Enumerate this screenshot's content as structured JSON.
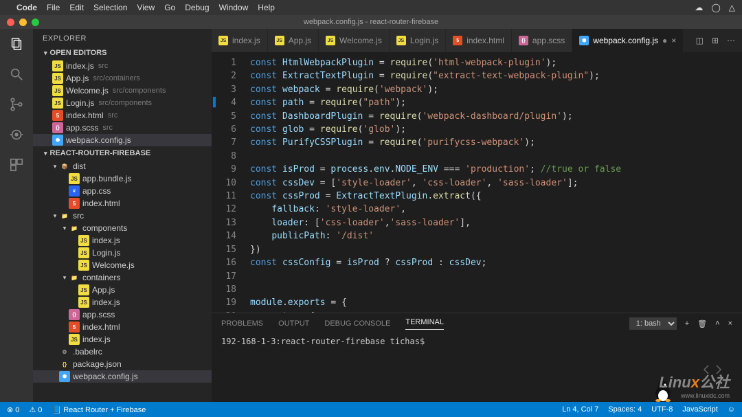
{
  "mac_menu": {
    "apple": "",
    "items": [
      "Code",
      "File",
      "Edit",
      "Selection",
      "View",
      "Go",
      "Debug",
      "Window",
      "Help"
    ],
    "right": [
      "☁",
      "◯",
      "△"
    ]
  },
  "titlebar": {
    "title": "webpack.config.js - react-router-firebase"
  },
  "sidebar": {
    "title": "EXPLORER",
    "open_editors_header": "OPEN EDITORS",
    "open_editors": [
      {
        "icon": "js",
        "name": "index.js",
        "desc": "src"
      },
      {
        "icon": "js",
        "name": "App.js",
        "desc": "src/containers"
      },
      {
        "icon": "js",
        "name": "Welcome.js",
        "desc": "src/components"
      },
      {
        "icon": "js",
        "name": "Login.js",
        "desc": "src/components"
      },
      {
        "icon": "html",
        "name": "index.html",
        "desc": "src"
      },
      {
        "icon": "scss",
        "name": "app.scss",
        "desc": "src"
      },
      {
        "icon": "cfg",
        "name": "webpack.config.js",
        "desc": "",
        "selected": true
      }
    ],
    "project_header": "REACT-ROUTER-FIREBASE",
    "tree": [
      {
        "depth": 1,
        "tw": "▾",
        "icon": "dist",
        "glyph": "📦",
        "name": "dist"
      },
      {
        "depth": 2,
        "icon": "js",
        "name": "app.bundle.js"
      },
      {
        "depth": 2,
        "icon": "css",
        "name": "app.css"
      },
      {
        "depth": 2,
        "icon": "html",
        "name": "index.html"
      },
      {
        "depth": 1,
        "tw": "▾",
        "icon": "src",
        "glyph": "📁",
        "name": "src"
      },
      {
        "depth": 2,
        "tw": "▾",
        "icon": "fold",
        "glyph": "📁",
        "name": "components"
      },
      {
        "depth": 3,
        "icon": "js",
        "name": "index.js"
      },
      {
        "depth": 3,
        "icon": "js",
        "name": "Login.js"
      },
      {
        "depth": 3,
        "icon": "js",
        "name": "Welcome.js"
      },
      {
        "depth": 2,
        "tw": "▾",
        "icon": "fold",
        "glyph": "📁",
        "name": "containers"
      },
      {
        "depth": 3,
        "icon": "js",
        "name": "App.js"
      },
      {
        "depth": 3,
        "icon": "js",
        "name": "index.js"
      },
      {
        "depth": 2,
        "icon": "scss",
        "name": "app.scss"
      },
      {
        "depth": 2,
        "icon": "html",
        "name": "index.html"
      },
      {
        "depth": 2,
        "icon": "js",
        "name": "index.js"
      },
      {
        "depth": 1,
        "icon": "babel",
        "glyph": "⚙",
        "name": ".babelrc"
      },
      {
        "depth": 1,
        "icon": "json",
        "glyph": "{}",
        "name": "package.json"
      },
      {
        "depth": 1,
        "icon": "cfg",
        "name": "webpack.config.js",
        "selected": true
      }
    ]
  },
  "tabs": [
    {
      "icon": "js",
      "label": "index.js"
    },
    {
      "icon": "js",
      "label": "App.js"
    },
    {
      "icon": "js",
      "label": "Welcome.js"
    },
    {
      "icon": "js",
      "label": "Login.js"
    },
    {
      "icon": "html",
      "label": "index.html"
    },
    {
      "icon": "scss",
      "label": "app.scss"
    },
    {
      "icon": "cfg",
      "label": "webpack.config.js",
      "active": true,
      "dirty": true
    }
  ],
  "code": {
    "lines": [
      [
        {
          "t": "const ",
          "c": "kw"
        },
        {
          "t": "HtmlWebpackPlugin",
          "c": "vr"
        },
        {
          "t": " = ",
          "c": "op"
        },
        {
          "t": "require",
          "c": "fn"
        },
        {
          "t": "(",
          "c": "op"
        },
        {
          "t": "'html-webpack-plugin'",
          "c": "st"
        },
        {
          "t": ");",
          "c": "op"
        }
      ],
      [
        {
          "t": "const ",
          "c": "kw"
        },
        {
          "t": "ExtractTextPlugin",
          "c": "vr"
        },
        {
          "t": " = ",
          "c": "op"
        },
        {
          "t": "require",
          "c": "fn"
        },
        {
          "t": "(",
          "c": "op"
        },
        {
          "t": "\"extract-text-webpack-plugin\"",
          "c": "st"
        },
        {
          "t": ");",
          "c": "op"
        }
      ],
      [
        {
          "t": "const ",
          "c": "kw"
        },
        {
          "t": "webpack",
          "c": "vr"
        },
        {
          "t": " = ",
          "c": "op"
        },
        {
          "t": "require",
          "c": "fn"
        },
        {
          "t": "(",
          "c": "op"
        },
        {
          "t": "'webpack'",
          "c": "st"
        },
        {
          "t": ");",
          "c": "op"
        }
      ],
      [
        {
          "t": "const ",
          "c": "kw"
        },
        {
          "t": "path",
          "c": "vr"
        },
        {
          "t": " = ",
          "c": "op"
        },
        {
          "t": "require",
          "c": "fn"
        },
        {
          "t": "(",
          "c": "op"
        },
        {
          "t": "\"path\"",
          "c": "st"
        },
        {
          "t": ");",
          "c": "op"
        }
      ],
      [
        {
          "t": "const ",
          "c": "kw"
        },
        {
          "t": "DashboardPlugin",
          "c": "vr"
        },
        {
          "t": " = ",
          "c": "op"
        },
        {
          "t": "require",
          "c": "fn"
        },
        {
          "t": "(",
          "c": "op"
        },
        {
          "t": "'webpack-dashboard/plugin'",
          "c": "st"
        },
        {
          "t": ");",
          "c": "op"
        }
      ],
      [
        {
          "t": "const ",
          "c": "kw"
        },
        {
          "t": "glob",
          "c": "vr"
        },
        {
          "t": " = ",
          "c": "op"
        },
        {
          "t": "require",
          "c": "fn"
        },
        {
          "t": "(",
          "c": "op"
        },
        {
          "t": "'glob'",
          "c": "st"
        },
        {
          "t": ");",
          "c": "op"
        }
      ],
      [
        {
          "t": "const ",
          "c": "kw"
        },
        {
          "t": "PurifyCSSPlugin",
          "c": "vr"
        },
        {
          "t": " = ",
          "c": "op"
        },
        {
          "t": "require",
          "c": "fn"
        },
        {
          "t": "(",
          "c": "op"
        },
        {
          "t": "'purifycss-webpack'",
          "c": "st"
        },
        {
          "t": ");",
          "c": "op"
        }
      ],
      [],
      [
        {
          "t": "const ",
          "c": "kw"
        },
        {
          "t": "isProd",
          "c": "vr"
        },
        {
          "t": " = ",
          "c": "op"
        },
        {
          "t": "process",
          "c": "pr"
        },
        {
          "t": ".",
          "c": "op"
        },
        {
          "t": "env",
          "c": "pr"
        },
        {
          "t": ".",
          "c": "op"
        },
        {
          "t": "NODE_ENV",
          "c": "pr"
        },
        {
          "t": " === ",
          "c": "op"
        },
        {
          "t": "'production'",
          "c": "st"
        },
        {
          "t": "; ",
          "c": "op"
        },
        {
          "t": "//true or false",
          "c": "cm"
        }
      ],
      [
        {
          "t": "const ",
          "c": "kw"
        },
        {
          "t": "cssDev",
          "c": "vr"
        },
        {
          "t": " = [",
          "c": "op"
        },
        {
          "t": "'style-loader'",
          "c": "st"
        },
        {
          "t": ", ",
          "c": "op"
        },
        {
          "t": "'css-loader'",
          "c": "st"
        },
        {
          "t": ", ",
          "c": "op"
        },
        {
          "t": "'sass-loader'",
          "c": "st"
        },
        {
          "t": "];",
          "c": "op"
        }
      ],
      [
        {
          "t": "const ",
          "c": "kw"
        },
        {
          "t": "cssProd",
          "c": "vr"
        },
        {
          "t": " = ",
          "c": "op"
        },
        {
          "t": "ExtractTextPlugin",
          "c": "pr"
        },
        {
          "t": ".",
          "c": "op"
        },
        {
          "t": "extract",
          "c": "fn"
        },
        {
          "t": "({",
          "c": "op"
        }
      ],
      [
        {
          "t": "    ",
          "c": "op"
        },
        {
          "t": "fallback",
          "c": "pr"
        },
        {
          "t": ": ",
          "c": "op"
        },
        {
          "t": "'style-loader'",
          "c": "st"
        },
        {
          "t": ",",
          "c": "op"
        }
      ],
      [
        {
          "t": "    ",
          "c": "op"
        },
        {
          "t": "loader",
          "c": "pr"
        },
        {
          "t": ": [",
          "c": "op"
        },
        {
          "t": "'css-loader'",
          "c": "st"
        },
        {
          "t": ",",
          "c": "op"
        },
        {
          "t": "'sass-loader'",
          "c": "st"
        },
        {
          "t": "],",
          "c": "op"
        }
      ],
      [
        {
          "t": "    ",
          "c": "op"
        },
        {
          "t": "publicPath",
          "c": "pr"
        },
        {
          "t": ": ",
          "c": "op"
        },
        {
          "t": "'/dist'",
          "c": "st"
        }
      ],
      [
        {
          "t": "})",
          "c": "op"
        }
      ],
      [
        {
          "t": "const ",
          "c": "kw"
        },
        {
          "t": "cssConfig",
          "c": "vr"
        },
        {
          "t": " = ",
          "c": "op"
        },
        {
          "t": "isProd",
          "c": "pr"
        },
        {
          "t": " ? ",
          "c": "op"
        },
        {
          "t": "cssProd",
          "c": "pr"
        },
        {
          "t": " : ",
          "c": "op"
        },
        {
          "t": "cssDev",
          "c": "pr"
        },
        {
          "t": ";",
          "c": "op"
        }
      ],
      [],
      [],
      [
        {
          "t": "module",
          "c": "pr"
        },
        {
          "t": ".",
          "c": "op"
        },
        {
          "t": "exports",
          "c": "pr"
        },
        {
          "t": " = {",
          "c": "op"
        }
      ],
      [
        {
          "t": "    ",
          "c": "op"
        },
        {
          "t": "entry",
          "c": "pr"
        },
        {
          "t": ": {",
          "c": "op"
        }
      ]
    ],
    "modified_line": 4
  },
  "panel": {
    "tabs": [
      "PROBLEMS",
      "OUTPUT",
      "DEBUG CONSOLE",
      "TERMINAL"
    ],
    "active": "TERMINAL",
    "select": "1: bash",
    "terminal": "192-168-1-3:react-router-firebase tichas$ "
  },
  "status": {
    "errors": "⊗ 0",
    "warnings": "⚠ 0",
    "branch": "React Router + Firebase",
    "ln": "Ln 4, Col 7",
    "spaces": "Spaces: 4",
    "enc": "UTF-8",
    "lang": "JavaScript",
    "smile": "☺"
  },
  "watermark": {
    "a": "Linu",
    "b": "x",
    "c": "公社",
    "sub": "www.linuxidc.com"
  }
}
